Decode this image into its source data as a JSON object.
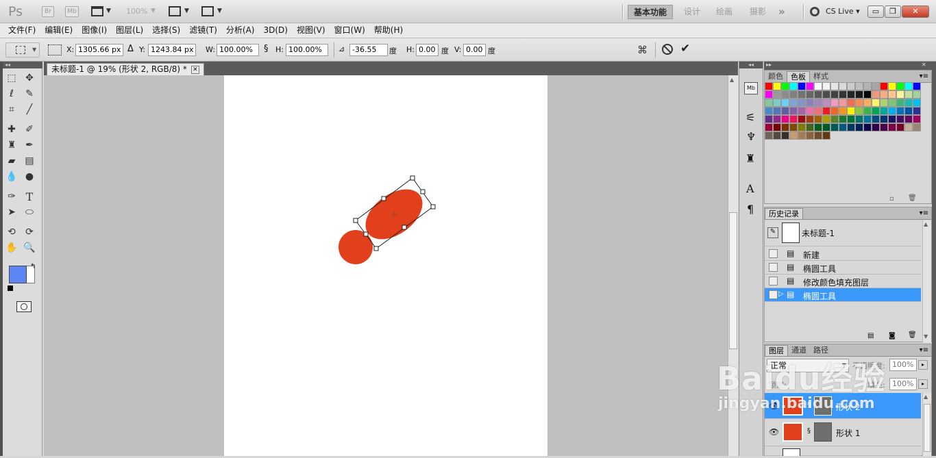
{
  "app": {
    "logo": "Ps",
    "bridge": "Br",
    "minibridge": "Mb",
    "zoom": "100%",
    "workspaces": [
      "基本功能",
      "设计",
      "绘画",
      "摄影"
    ],
    "more_workspaces": "»",
    "cs_live": "CS Live",
    "win_buttons": {
      "minimize": "▭",
      "restore": "❐",
      "close": "✕"
    }
  },
  "menu": [
    "文件(F)",
    "编辑(E)",
    "图像(I)",
    "图层(L)",
    "选择(S)",
    "滤镜(T)",
    "分析(A)",
    "3D(D)",
    "视图(V)",
    "窗口(W)",
    "帮助(H)"
  ],
  "options": {
    "x_label": "X:",
    "x_value": "1305.66 px",
    "y_label": "Y:",
    "y_value": "1243.84 px",
    "w_label": "W:",
    "w_value": "100.00%",
    "h_label": "H:",
    "h_value": "100.00%",
    "angle_value": "-36.55",
    "angle_unit": "度",
    "hskew_label": "H:",
    "hskew_value": "0.00",
    "hskew_unit": "度",
    "vskew_label": "V:",
    "vskew_value": "0.00",
    "vskew_unit": "度"
  },
  "document": {
    "tab_title": "未标题-1 @ 19% (形状 2, RGB/8) *",
    "shape_color": "#e2401c"
  },
  "swatches_panel": {
    "tabs": [
      "颜色",
      "色板",
      "样式"
    ],
    "active": "色板",
    "colors": [
      "#ff0000",
      "#ffff00",
      "#00ff00",
      "#00ffff",
      "#0000ff",
      "#ff00ff",
      "#ffffff",
      "#f2f2f2",
      "#e6e6e6",
      "#d9d9d9",
      "#cccccc",
      "#bfbfbf",
      "#b3b3b3",
      "#a6a6a6",
      "#ff0000",
      "#ffff00",
      "#00ff00",
      "#00ffff",
      "#0000ff",
      "#ff00ff",
      "#999999",
      "#8c8c8c",
      "#808080",
      "#737373",
      "#666666",
      "#595959",
      "#4d4d4d",
      "#404040",
      "#333333",
      "#262626",
      "#1a1a1a",
      "#000000",
      "#f7977a",
      "#f9ad81",
      "#fdc68a",
      "#fff79a",
      "#c4df9b",
      "#a3d39c",
      "#82ca9d",
      "#7bcdc8",
      "#6ecff6",
      "#7ea7d8",
      "#8493ca",
      "#8882be",
      "#a187be",
      "#bc8dbf",
      "#f49ac2",
      "#f6989d",
      "#f26c4f",
      "#f68e55",
      "#fbaf5c",
      "#fff467",
      "#acd372",
      "#7cc576",
      "#3bb878",
      "#1abbb4",
      "#00bff3",
      "#438ccb",
      "#5574b9",
      "#605ca8",
      "#855fa8",
      "#a763a8",
      "#f06ea9",
      "#f26d7d",
      "#ed1c24",
      "#f26522",
      "#f7941d",
      "#fff200",
      "#8dc63f",
      "#39b54a",
      "#00a651",
      "#00a99d",
      "#00aeef",
      "#0072bc",
      "#0054a6",
      "#2e3192",
      "#662d91",
      "#92278f",
      "#ec008c",
      "#ed145b",
      "#9e0b0f",
      "#a0410d",
      "#a36209",
      "#aba000",
      "#598527",
      "#1a7b30",
      "#007236",
      "#00746b",
      "#0076a3",
      "#004b80",
      "#003471",
      "#1b1464",
      "#440e62",
      "#630460",
      "#9e005d",
      "#9e0039",
      "#790000",
      "#7b2e00",
      "#7d4900",
      "#827b00",
      "#406618",
      "#005e20",
      "#005826",
      "#005952",
      "#005b7f",
      "#003663",
      "#002157",
      "#0d004c",
      "#32004b",
      "#4b0049",
      "#7b0046",
      "#7a0026",
      "#c7b299",
      "#998675",
      "#736357",
      "#534741",
      "#37302a",
      "#c69c6d",
      "#a67c52",
      "#8c6239",
      "#754c24",
      "#603913"
    ]
  },
  "history_panel": {
    "tab": "历史记录",
    "snapshot": "未标题-1",
    "items": [
      "新建",
      "椭圆工具",
      "修改颜色填充图层",
      "椭圆工具"
    ],
    "selected_index": 3
  },
  "layers_panel": {
    "tabs": [
      "图层",
      "通道",
      "路径"
    ],
    "blend_mode": "正常",
    "opacity_label": "不透明度:",
    "opacity_value": "100%",
    "lock_label": "锁定:",
    "fill_label": "填充:",
    "fill_value": "100%",
    "layers": [
      "形状 2",
      "形状 1"
    ]
  },
  "watermark": {
    "brand": "Baidu经验",
    "url": "jingyan.baidu.com"
  }
}
